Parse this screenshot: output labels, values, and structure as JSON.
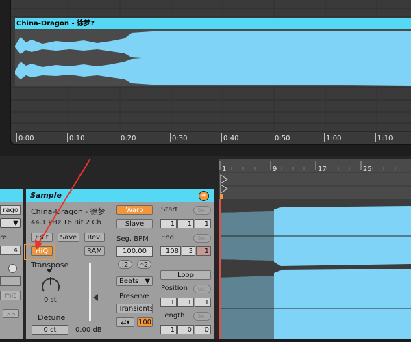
{
  "arrangement": {
    "clip_title": "China-Dragon - 徐梦?",
    "time_ruler": [
      "0:00",
      "0:10",
      "0:20",
      "0:30",
      "0:40",
      "0:50",
      "1:00",
      "1:10"
    ]
  },
  "sample_ruler": [
    "1",
    "9",
    "17",
    "25"
  ],
  "left_panel": {
    "name_fragment": "rago",
    "selector_arrow": "▼",
    "label_fragment": "re",
    "value": "4",
    "button_fragment": "mit",
    "forward": ">>"
  },
  "clip_view": {
    "header": "Sample",
    "sample_name": "China-Dragon - 徐梦",
    "sample_info": "44.1 kHz 16 Bit 2 Ch",
    "edit_label": "Edit",
    "save_label": "Save",
    "rev_label": "Rev.",
    "hiq_label": "HiQ",
    "ram_label": "RAM",
    "transpose_label": "Transpose",
    "transpose_value": "0 st",
    "detune_label": "Detune",
    "detune_value": "0 ct",
    "volume_value": "0.00 dB",
    "warp_label": "Warp",
    "slave_label": "Slave",
    "seg_bpm_label": "Seg. BPM",
    "seg_bpm_value": "100.00",
    "half_label": ":2",
    "double_label": "*2",
    "warp_mode": "Beats",
    "preserve_label": "Preserve",
    "preserve_value": "Transients",
    "loop_style_value": "100",
    "start_label": "Start",
    "start_values": [
      "1",
      "1",
      "1"
    ],
    "end_label": "End",
    "end_values": [
      "108",
      "3",
      "1"
    ],
    "loop_label": "Loop",
    "position_label": "Position",
    "position_values": [
      "1",
      "1",
      "1"
    ],
    "length_label": "Length",
    "length_values": [
      "1",
      "0",
      "0"
    ],
    "set_label": "Set"
  },
  "colors": {
    "clip_cyan": "#55d8f4",
    "wave_blue": "#7fd3f6",
    "warp_orange": "#f0963c",
    "annotation_red": "#e8332a"
  }
}
